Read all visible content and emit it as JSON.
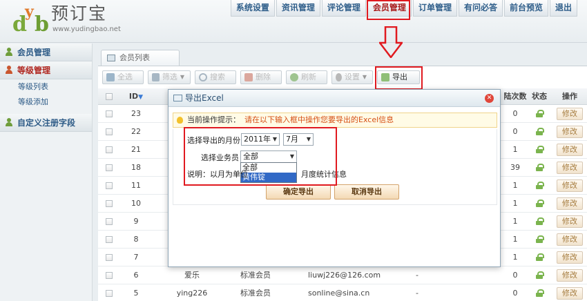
{
  "app": {
    "logo_text": "预订宝",
    "logo_url": "www.yudingbao.net",
    "logo_mark": [
      "d",
      "y",
      "b"
    ]
  },
  "nav": {
    "items": [
      {
        "label": "系统设置"
      },
      {
        "label": "资讯管理"
      },
      {
        "label": "评论管理"
      },
      {
        "label": "会员管理",
        "active": true
      },
      {
        "label": "订单管理"
      },
      {
        "label": "有问必答"
      },
      {
        "label": "前台预览"
      },
      {
        "label": "退出"
      }
    ]
  },
  "sidebar": {
    "groups": [
      {
        "label": "会员管理"
      },
      {
        "label": "等级管理",
        "active": true,
        "sub": [
          "等级列表",
          "等级添加"
        ]
      },
      {
        "label": "自定义注册字段"
      }
    ]
  },
  "main": {
    "tab_label": "会员列表",
    "toolbar": [
      {
        "label": "全选"
      },
      {
        "label": "筛选"
      },
      {
        "label": "搜索"
      },
      {
        "label": "删除"
      },
      {
        "label": "刷新"
      },
      {
        "label": "设置"
      },
      {
        "label": "导出"
      }
    ],
    "table": {
      "headers": {
        "id": "ID",
        "login_count": "陆次数",
        "status": "状态",
        "action": "操作"
      },
      "edit_label": "修改",
      "rows": [
        {
          "id": "23",
          "count": "0"
        },
        {
          "id": "22",
          "count": "0"
        },
        {
          "id": "21",
          "count": "1"
        },
        {
          "id": "18",
          "count": "39"
        },
        {
          "id": "11",
          "count": "1"
        },
        {
          "id": "10",
          "count": "1"
        },
        {
          "id": "9",
          "count": "1"
        },
        {
          "id": "8",
          "count": "1"
        },
        {
          "id": "7",
          "count": "1"
        },
        {
          "id": "6",
          "name": "爱乐",
          "level": "标准会员",
          "email": "liuwj226@126.com",
          "dash": "-",
          "count": "0"
        },
        {
          "id": "5",
          "name": "ying226",
          "level": "标准会员",
          "email": "sonline@sina.cn",
          "dash": "-",
          "count": "0"
        }
      ]
    }
  },
  "dialog": {
    "title": "导出Excel",
    "close_symbol": "✕",
    "tip_label": "当前操作提示：",
    "tip_message": "请在以下输入框中操作您要导出的Excel信息",
    "month_label": "选择导出的月份",
    "year_value": "2011年",
    "month_value": "7月",
    "staff_label": "选择业务员",
    "staff_value": "全部",
    "staff_options": [
      "全部",
      "黄伟锭"
    ],
    "note_left": "说明：以月为单位",
    "note_right": "月度统计信息",
    "confirm_label": "确定导出",
    "cancel_label": "取消导出"
  },
  "colors": {
    "accent_red": "#e0191f",
    "nav_text": "#2f5e8a",
    "tip_text": "#d64f14"
  }
}
